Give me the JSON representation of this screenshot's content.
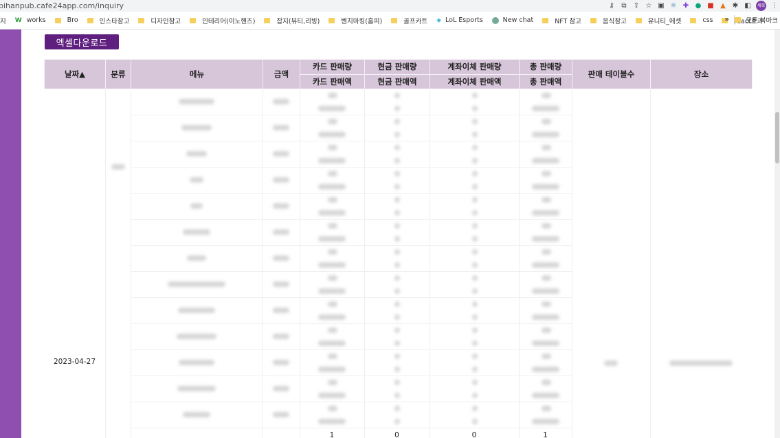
{
  "browser": {
    "url": "bihanpub.cafe24app.com/inquiry",
    "profile": "세희",
    "bookmarks": [
      {
        "label": "지",
        "icon": "none"
      },
      {
        "label": "works",
        "icon": "works-icon"
      },
      {
        "label": "Bro",
        "icon": "folder-icon"
      },
      {
        "label": "인스타참고",
        "icon": "folder-icon"
      },
      {
        "label": "디자인참고",
        "icon": "folder-icon"
      },
      {
        "label": "인테리어(이노핸즈)",
        "icon": "folder-icon"
      },
      {
        "label": "잡지(뷰티,리빙)",
        "icon": "folder-icon"
      },
      {
        "label": "벤치마킹(홈피)",
        "icon": "folder-icon"
      },
      {
        "label": "골프카트",
        "icon": "folder-icon"
      },
      {
        "label": "LoL Esports",
        "icon": "lol-icon"
      },
      {
        "label": "New chat",
        "icon": "chat-icon"
      },
      {
        "label": "NFT 참고",
        "icon": "folder-icon"
      },
      {
        "label": "음식참고",
        "icon": "folder-icon"
      },
      {
        "label": "유니티_에셋",
        "icon": "folder-icon"
      },
      {
        "label": "css",
        "icon": "folder-icon"
      },
      {
        "label": "react효과",
        "icon": "folder-icon"
      }
    ],
    "more": "»",
    "all_bookmarks": "모든 북마크"
  },
  "toolbar": {
    "excel_label": "엑셀다운로드"
  },
  "table": {
    "headers": {
      "date": "날짜▲",
      "category": "분류",
      "menu": "메뉴",
      "price": "금액",
      "card_qty": "카드 판매량",
      "card_amt": "카드 판매액",
      "cash_qty": "현금 판매량",
      "cash_amt": "현금 판매액",
      "transfer_qty": "계좌이체 판매량",
      "transfer_amt": "계좌이체 판매액",
      "total_qty": "총 판매량",
      "total_amt": "총 판매액",
      "tables": "판매 테이블수",
      "place": "장소"
    },
    "date": "2023-04-27",
    "totals": {
      "card": "1",
      "cash": "0",
      "transfer": "0",
      "total": "1"
    }
  }
}
